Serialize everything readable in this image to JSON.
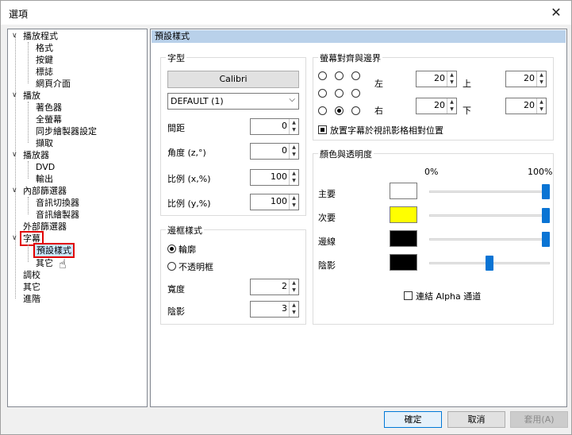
{
  "window": {
    "title": "選項"
  },
  "tree": [
    {
      "label": "播放程式",
      "level": 0,
      "expander": "∨"
    },
    {
      "label": "格式",
      "level": 1
    },
    {
      "label": "按鍵",
      "level": 1
    },
    {
      "label": "標誌",
      "level": 1
    },
    {
      "label": "網頁介面",
      "level": 1
    },
    {
      "label": "播放",
      "level": 0,
      "expander": "∨"
    },
    {
      "label": "著色器",
      "level": 1
    },
    {
      "label": "全螢幕",
      "level": 1
    },
    {
      "label": "同步繪製器設定",
      "level": 1
    },
    {
      "label": "擷取",
      "level": 1
    },
    {
      "label": "播放器",
      "level": 0,
      "expander": "∨"
    },
    {
      "label": "DVD",
      "level": 1
    },
    {
      "label": "輸出",
      "level": 1
    },
    {
      "label": "內部篩選器",
      "level": 0,
      "expander": "∨"
    },
    {
      "label": "音訊切換器",
      "level": 1
    },
    {
      "label": "音訊繪製器",
      "level": 1
    },
    {
      "label": "外部篩選器",
      "level": 0
    },
    {
      "label": "字幕",
      "level": 0,
      "expander": "∨"
    },
    {
      "label": "預設樣式",
      "level": 1
    },
    {
      "label": "其它",
      "level": 1
    },
    {
      "label": "調校",
      "level": 0
    },
    {
      "label": "其它",
      "level": 0
    },
    {
      "label": "進階",
      "level": 0
    }
  ],
  "panel": {
    "header": "預設樣式",
    "font_group": {
      "legend": "字型",
      "font_button": "Calibri",
      "charset": "DEFAULT (1)",
      "spacing_label": "間距",
      "spacing": "0",
      "angle_label": "角度 (z,°)",
      "angle": "0",
      "scale_x_label": "比例 (x,%)",
      "scale_x": "100",
      "scale_y_label": "比例 (y,%)",
      "scale_y": "100"
    },
    "border_group": {
      "legend": "邊框樣式",
      "outline_label": "輪廓",
      "opaque_label": "不透明框",
      "width_label": "寬度",
      "width": "2",
      "shadow_label": "陰影",
      "shadow": "3"
    },
    "margin_group": {
      "legend": "螢幕對齊與邊界",
      "left_label": "左",
      "left": "20",
      "top_label": "上",
      "top": "20",
      "right_label": "右",
      "right": "20",
      "bottom_label": "下",
      "bottom": "20",
      "relative_label": "放置字幕於視訊影格相對位置",
      "selected_position": "bottom-center"
    },
    "color_group": {
      "legend": "顏色與透明度",
      "min_label": "0%",
      "max_label": "100%",
      "rows": [
        {
          "label": "主要",
          "color": "#ffffff",
          "opacity_fraction": 1.0
        },
        {
          "label": "次要",
          "color": "#ffff00",
          "opacity_fraction": 1.0
        },
        {
          "label": "邊線",
          "color": "#000000",
          "opacity_fraction": 1.0
        },
        {
          "label": "陰影",
          "color": "#000000",
          "opacity_fraction": 0.5
        }
      ],
      "link_alpha_label": "連結 Alpha 通道"
    }
  },
  "buttons": {
    "ok": "確定",
    "cancel": "取消",
    "apply": "套用(A)"
  }
}
